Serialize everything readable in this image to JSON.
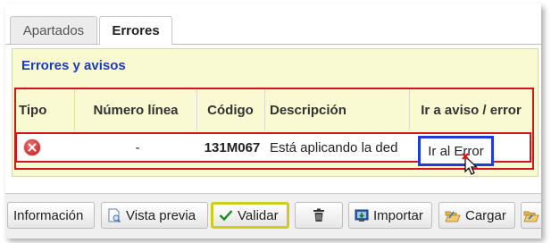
{
  "tabs": [
    {
      "label": "Apartados",
      "active": false
    },
    {
      "label": "Errores",
      "active": true
    }
  ],
  "panel": {
    "title": "Errores y avisos"
  },
  "table": {
    "columns": [
      "Tipo",
      "Número línea",
      "Código",
      "Descripción",
      "Ir a aviso / error"
    ],
    "rows": [
      {
        "type_icon": "error-icon",
        "line_number": "-",
        "code": "131M067",
        "description": "Está aplicando la ded",
        "action_label": "Ir al Error"
      }
    ]
  },
  "toolbar": {
    "buttons": [
      {
        "label": "Información",
        "icon": ""
      },
      {
        "label": "Vista previa",
        "icon": "document-preview-icon"
      },
      {
        "label": "Validar",
        "icon": "checkmark-icon"
      },
      {
        "label": "",
        "icon": "trash-icon"
      },
      {
        "label": "Importar",
        "icon": "import-icon"
      },
      {
        "label": "Cargar",
        "icon": "open-folder-icon"
      }
    ]
  },
  "colors": {
    "header_text": "#1a3cb8",
    "panel_bg": "#fafad2",
    "highlight_red": "#d4141a",
    "highlight_blue": "#1f3dd6",
    "highlight_yellow": "#d0cc1c"
  }
}
